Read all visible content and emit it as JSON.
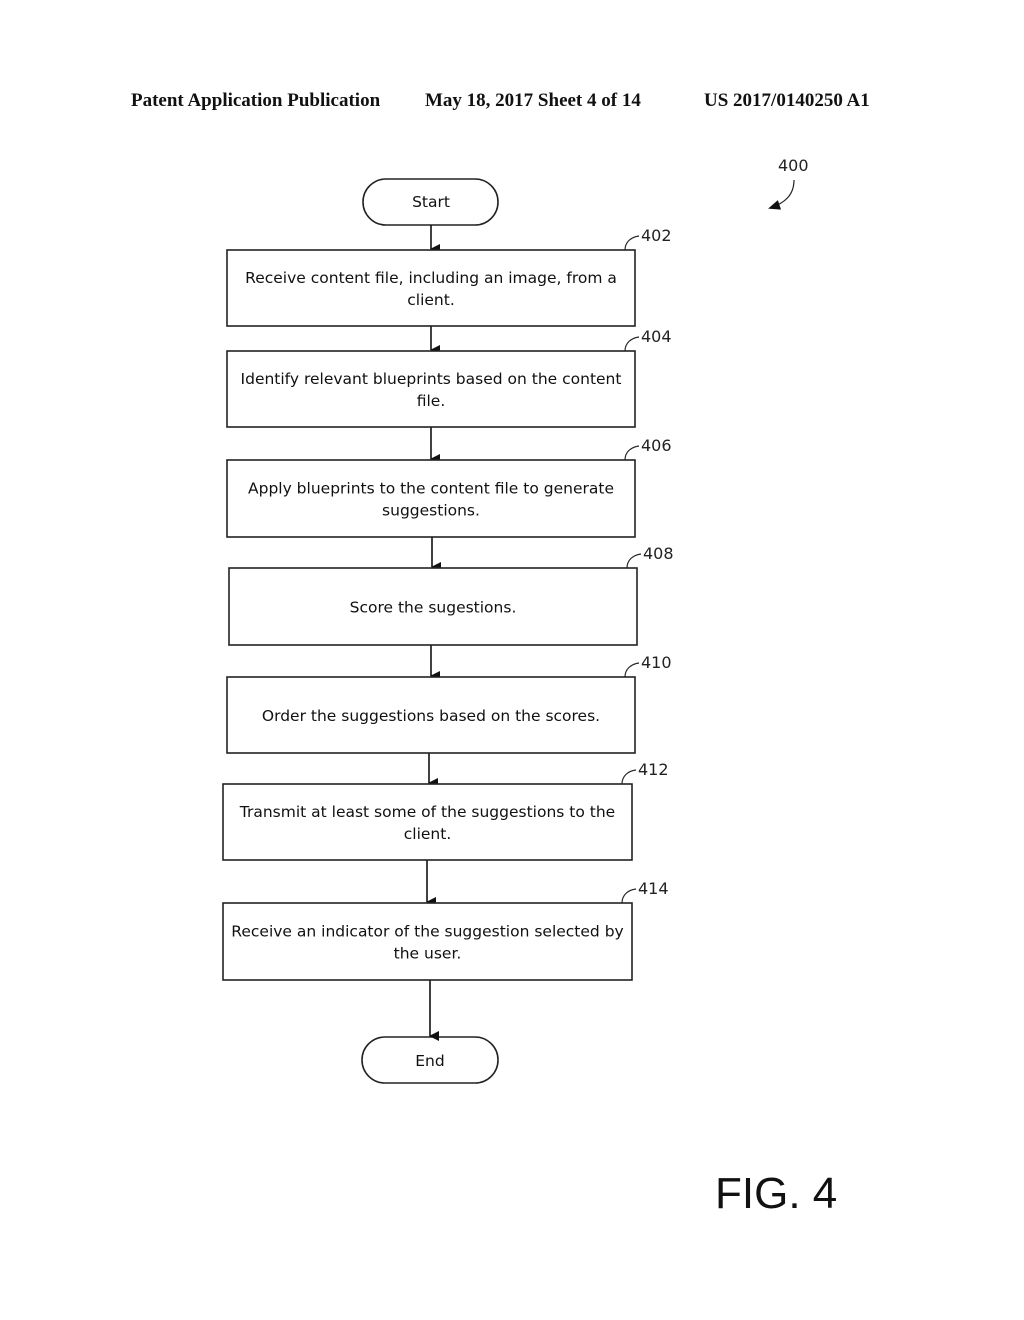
{
  "header": {
    "publication": "Patent Application Publication",
    "date_sheet": "May 18, 2017  Sheet 4 of 14",
    "number": "US 2017/0140250 A1"
  },
  "figure": {
    "label": "FIG. 4",
    "reference": "400"
  },
  "flowchart": {
    "start": "Start",
    "end": "End",
    "steps": [
      {
        "ref": "402",
        "lines": [
          "Receive content file, including an image, from a",
          "client."
        ]
      },
      {
        "ref": "404",
        "lines": [
          "Identify relevant blueprints based on the content",
          "file."
        ]
      },
      {
        "ref": "406",
        "lines": [
          "Apply blueprints to the content file to generate",
          "suggestions."
        ]
      },
      {
        "ref": "408",
        "lines": [
          "Score the sugestions."
        ]
      },
      {
        "ref": "410",
        "lines": [
          "Order the suggestions based on the scores."
        ]
      },
      {
        "ref": "412",
        "lines": [
          "Transmit at least some of the suggestions to the",
          "client."
        ]
      },
      {
        "ref": "414",
        "lines": [
          "Receive an indicator of the suggestion selected by",
          "the user."
        ]
      }
    ]
  }
}
